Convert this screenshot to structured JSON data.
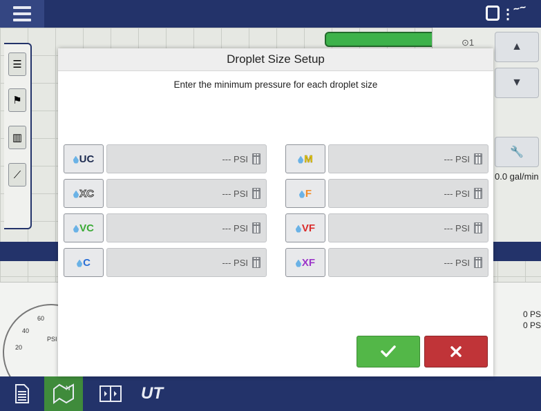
{
  "dialog": {
    "title": "Droplet Size Setup",
    "subtitle": "Enter the minimum pressure for each droplet size",
    "left_column": [
      {
        "code": "UC",
        "color": "#1c2a4f",
        "value": "--- PSI"
      },
      {
        "code": "XC",
        "color": "#ffffff",
        "outline": "#333333",
        "value": "--- PSI"
      },
      {
        "code": "VC",
        "color": "#3aaa35",
        "value": "--- PSI"
      },
      {
        "code": "C",
        "color": "#2a6fd6",
        "value": "--- PSI"
      }
    ],
    "right_column": [
      {
        "code": "M",
        "color": "#f2d31b",
        "value": "--- PSI"
      },
      {
        "code": "F",
        "color": "#f28c28",
        "value": "--- PSI"
      },
      {
        "code": "VF",
        "color": "#d92b2b",
        "value": "--- PSI"
      },
      {
        "code": "XF",
        "color": "#9b35c9",
        "value": "--- PSI"
      }
    ],
    "ok_icon": "checkmark-icon",
    "cancel_icon": "x-icon"
  },
  "background": {
    "right_panel_label": "⊙1",
    "rate_text": "0.0 gal/min",
    "psi_right_1": "0 PS",
    "psi_right_2": "0 PS",
    "gauge_labels": [
      "60",
      "40",
      "20",
      "PSI"
    ]
  },
  "bottombar": {
    "items": [
      "run-report-icon",
      "field-operation-icon",
      "split-screen-icon",
      "ut-icon"
    ],
    "ut_label": "UT"
  },
  "colors": {
    "topbar": "#23336a",
    "accent_green": "#53b748",
    "cancel_red": "#c03438"
  }
}
